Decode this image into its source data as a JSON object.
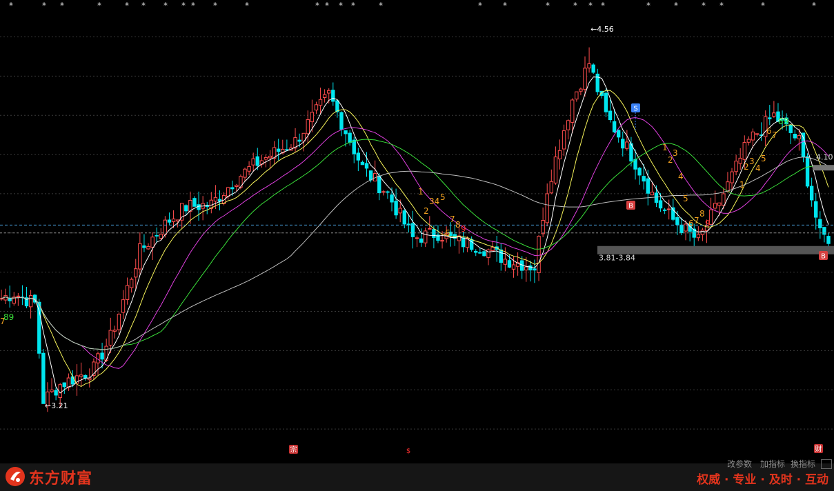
{
  "chart_data": {
    "type": "candlestick",
    "ylim": [
      3.0,
      4.72
    ],
    "y_gridlines": [
      3.1,
      3.25,
      3.4,
      3.55,
      3.7,
      3.85,
      4.0,
      4.15,
      4.3,
      4.45,
      4.6
    ],
    "grid": "horizontal-dashed",
    "max_label": "4.56",
    "min_label": "3.21",
    "range_band_label": "3.81-3.84",
    "right_price_label": "4.10",
    "upper_band_label": "",
    "tag_S": "S",
    "tag_B": "B",
    "tag_B2": "B",
    "bottom_tags": [
      "宗",
      "$",
      "财"
    ],
    "seq_labels_1": [
      "7",
      "89"
    ],
    "seq_labels_2": [
      "1",
      "2",
      "34",
      "5",
      "6",
      "7",
      "8",
      "9"
    ],
    "seq_labels_3": [
      "1",
      "2",
      "3",
      "4",
      "5",
      "6",
      "7",
      "8",
      "9"
    ],
    "seq_labels_4": [
      "1",
      "2",
      "3",
      "4",
      "5",
      "6",
      "7",
      "89"
    ]
  },
  "colors": {
    "up": "#ff4d4d",
    "down": "#00e5ee",
    "ma_white": "#ffffff",
    "ma_yellow": "#f6f35a",
    "ma_magenta": "#e040e0",
    "ma_green": "#3adf3a",
    "ma_gray": "#bdbdbd",
    "seq_orange": "#f0a020",
    "seq_red": "#ff3030",
    "brand": "#e2341d"
  },
  "footer": {
    "brand": "东方财富",
    "slogan": "权威 · 专业 · 及时 · 互动",
    "tabs": [
      "改参数",
      "加指标",
      "换指标"
    ]
  }
}
